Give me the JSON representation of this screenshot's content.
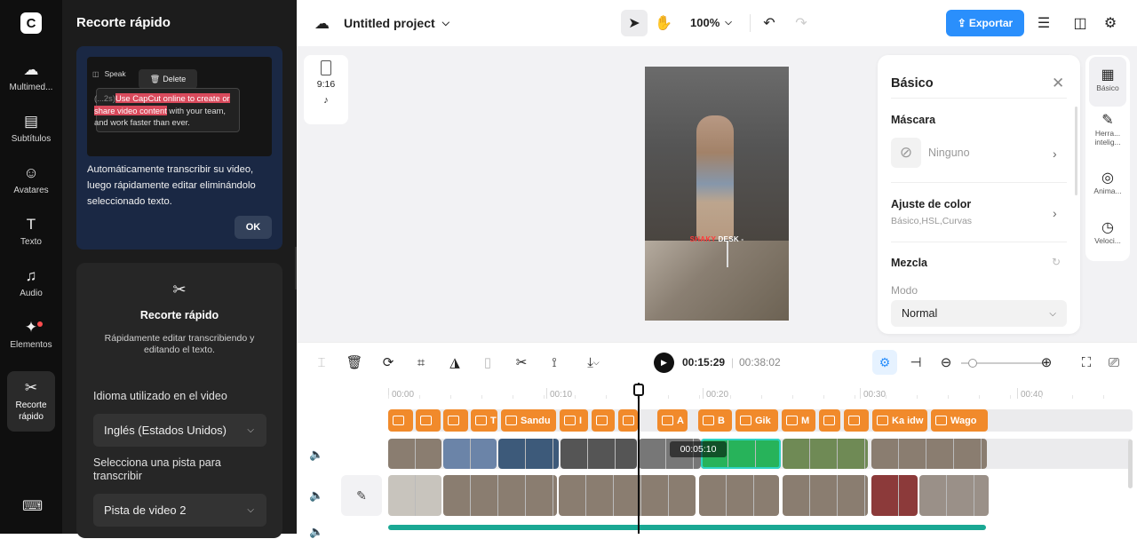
{
  "rail": {
    "logo": "C",
    "items": [
      {
        "label": "Multimed...",
        "icon": "cloud-upload-icon",
        "glyph": "☁"
      },
      {
        "label": "Subtítulos",
        "icon": "subtitles-icon",
        "glyph": "▤"
      },
      {
        "label": "Avatares",
        "icon": "avatar-icon",
        "glyph": "☺"
      },
      {
        "label": "Texto",
        "icon": "text-icon",
        "glyph": "T"
      },
      {
        "label": "Audio",
        "icon": "music-icon",
        "glyph": "♫"
      },
      {
        "label": "Elementos",
        "icon": "elements-icon",
        "glyph": "✦"
      },
      {
        "label": "Recorte\nrápido",
        "icon": "quick-cut-icon",
        "glyph": "✂"
      }
    ],
    "bottom_icon": "keyboard-icon",
    "bottom_glyph": "⌨"
  },
  "panel": {
    "title": "Recorte rápido",
    "tip": {
      "preview_speaker": "Speak",
      "preview_delete": "Delete",
      "preview_ellipsis": "(...2s)",
      "preview_highlight": "Use CapCut online to create or share video content",
      "preview_rest": " with your team, and work faster than ever.",
      "text": "Automáticamente transcribir su video, luego rápidamente editar eliminándolo seleccionado texto.",
      "ok": "OK"
    },
    "card": {
      "title": "Recorte rápido",
      "desc": "Rápidamente editar transcribiendo y editando el texto.",
      "language_label": "Idioma utilizado en el video",
      "language_value": "Inglés (Estados Unidos)",
      "track_label": "Selecciona una pista para transcribir",
      "track_value": "Pista de video 2"
    }
  },
  "topbar": {
    "project": "Untitled project",
    "zoom": "100%",
    "export": "Exportar"
  },
  "canvas": {
    "ratio": "9:16",
    "caption_red": "SHAKY",
    "caption_white": " DESK -"
  },
  "basic_panel": {
    "title": "Básico",
    "mask_label": "Máscara",
    "mask_value": "Ninguno",
    "color_label": "Ajuste de color",
    "color_sub": "Básico,HSL,Curvas",
    "blend_label": "Mezcla",
    "mode_label": "Modo",
    "mode_value": "Normal"
  },
  "right_tabs": [
    {
      "label": "Básico",
      "icon": "basic-icon",
      "glyph": "▦"
    },
    {
      "label": "Herra...\nintelig...",
      "icon": "magic-icon",
      "glyph": "✎"
    },
    {
      "label": "Anima...",
      "icon": "animation-icon",
      "glyph": "◎"
    },
    {
      "label": "Veloci...",
      "icon": "speed-icon",
      "glyph": "◷"
    }
  ],
  "timeline": {
    "current": "00:15:29",
    "total": "00:38:02",
    "ticks": [
      "00:00",
      "00:10",
      "00:20",
      "00:30",
      "00:40"
    ],
    "clip_badge": "00:05:10",
    "text_clips": [
      "",
      "",
      "",
      "T",
      "Sandu",
      "I",
      "",
      "",
      "A",
      "B",
      "Gik",
      "M",
      "",
      "",
      "Ka idw",
      "Wago"
    ]
  }
}
